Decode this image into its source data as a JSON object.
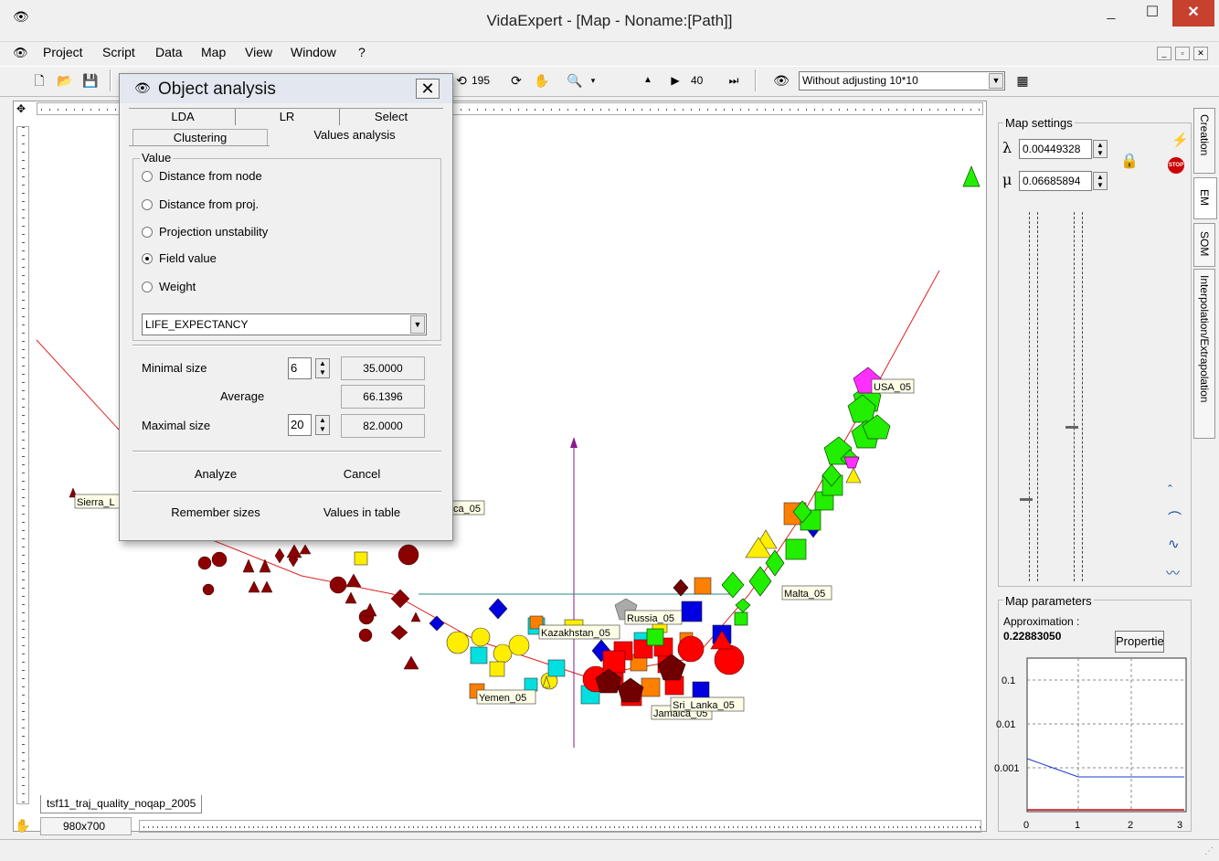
{
  "window": {
    "title": "VidaExpert - [Map - Noname:[Path]]",
    "min_glyph": "_",
    "max_glyph": "☐",
    "close_glyph": "✕"
  },
  "menu": {
    "items": [
      "Project",
      "Script",
      "Data",
      "Map",
      "View",
      "Window",
      "?"
    ]
  },
  "toolbar": {
    "value1": "195",
    "step_value": "40",
    "dropdown_value": "Without adjusting 10*10"
  },
  "map": {
    "tab_label": "tsf11_traj_quality_noqap_2005",
    "size_label": "980x700",
    "labels": {
      "usa": "USA_05",
      "sierra": "Sierra_L",
      "africa": "ca_05",
      "malta": "Malta_05",
      "russia": "Russia_05",
      "kazakhstan": "Kazakhstan_05",
      "yemen": "Yemen_05",
      "sri_lanka": "Sri_Lanka_05",
      "jamaica": "Jamaica_05"
    }
  },
  "dialog": {
    "title": "Object analysis",
    "tabs_row1": [
      "LDA",
      "LR",
      "Select"
    ],
    "tabs_row2": [
      "Clustering",
      "Values analysis"
    ],
    "group_label": "Value",
    "radios": [
      {
        "label": "Distance from node",
        "checked": false
      },
      {
        "label": "Distance from proj.",
        "checked": false
      },
      {
        "label": "Projection unstability",
        "checked": false
      },
      {
        "label": "Field value",
        "checked": true
      },
      {
        "label": "Weight",
        "checked": false
      }
    ],
    "field_select": "LIFE_EXPECTANCY",
    "minimal_size_label": "Minimal size",
    "minimal_size": "6",
    "minimal_value": "35.0000",
    "average_label": "Average",
    "average_value": "66.1396",
    "maximal_size_label": "Maximal size",
    "maximal_size": "20",
    "maximal_value": "82.0000",
    "analyze_label": "Analyze",
    "cancel_label": "Cancel",
    "remember_label": "Remember sizes",
    "table_label": "Values in table"
  },
  "right_panel": {
    "tabs": [
      "Creation",
      "EM",
      "SOM",
      "Interpolation/Extrapolation"
    ],
    "map_settings_label": "Map settings",
    "lambda_symbol": "λ",
    "lambda_value": "0.00449328",
    "mu_symbol": "μ",
    "mu_value": "0.06685894",
    "map_params_label": "Map parameters",
    "approximation_label": "Approximation :",
    "approximation_value": "0.22883050",
    "properties_label": "Propertie",
    "graph_y_ticks": [
      "0.1",
      "0.01",
      "0.001"
    ],
    "graph_x_ticks": [
      "0",
      "1",
      "2",
      "3"
    ]
  }
}
